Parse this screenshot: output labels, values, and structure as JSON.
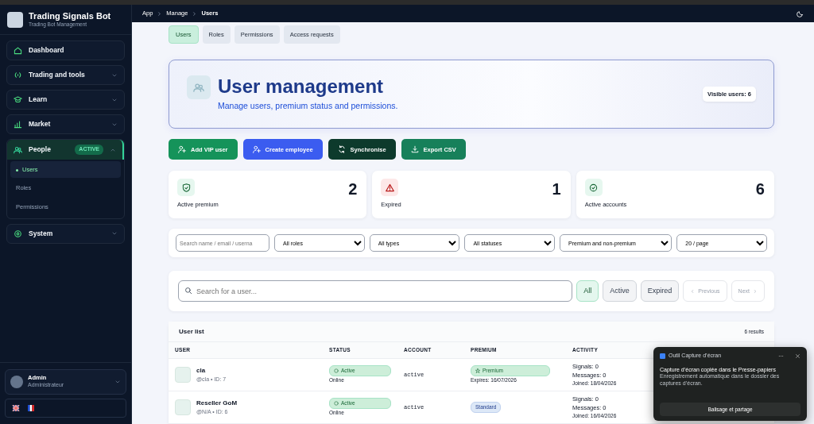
{
  "app": {
    "title": "Trading Signals Bot",
    "subtitle": "Trading Bot Management"
  },
  "sidebar": {
    "items": [
      {
        "label": "Dashboard",
        "expandable": false,
        "selected": false
      },
      {
        "label": "Trading and tools",
        "expandable": true,
        "expanded": false,
        "selected": false
      },
      {
        "label": "Learn",
        "expandable": true,
        "expanded": false,
        "selected": false
      },
      {
        "label": "Market",
        "expandable": true,
        "expanded": false,
        "selected": false
      },
      {
        "label": "People",
        "expandable": true,
        "expanded": true,
        "selected": true,
        "badge": "ACTIVE",
        "children": [
          {
            "label": "Users",
            "selected": true
          },
          {
            "label": "Roles",
            "selected": false
          },
          {
            "label": "Permissions",
            "selected": false
          }
        ]
      },
      {
        "label": "System",
        "expandable": true,
        "expanded": false,
        "selected": false
      }
    ]
  },
  "user": {
    "name": "Admin",
    "role": "Administrateur"
  },
  "breadcrumb": [
    "App",
    "Manage",
    "Users"
  ],
  "tabs": [
    {
      "label": "Users",
      "selected": true
    },
    {
      "label": "Roles",
      "selected": false
    },
    {
      "label": "Permissions",
      "selected": false
    },
    {
      "label": "Access requests",
      "selected": false
    }
  ],
  "header": {
    "title": "User management",
    "subtitle": "Manage users, premium status and permissions.",
    "badge": "Visible users: 6"
  },
  "actions": [
    {
      "label": "Add VIP user",
      "color": "#15935a"
    },
    {
      "label": "Create employee",
      "color": "#3b5cf0"
    },
    {
      "label": "Synchronise",
      "color": "#0d3a2c"
    },
    {
      "label": "Export CSV",
      "color": "#17805a"
    }
  ],
  "stats": [
    {
      "kind": "premium",
      "label": "Active premium",
      "value": "2"
    },
    {
      "kind": "expired",
      "label": "Expired",
      "value": "1"
    },
    {
      "kind": "accounts",
      "label": "Active accounts",
      "value": "6"
    }
  ],
  "filters": {
    "placeholder": "Search name / email / userna",
    "selects": [
      "All roles",
      "All types",
      "All statuses",
      "Premium and non-premium",
      "20 / page"
    ]
  },
  "search": {
    "placeholder": "Search for a user...",
    "segments": [
      {
        "label": "All",
        "selected": true
      },
      {
        "label": "Active",
        "selected": false
      },
      {
        "label": "Expired",
        "selected": false
      }
    ],
    "pager": [
      {
        "label": "Previous",
        "disabled": true
      },
      {
        "label": "Next",
        "disabled": true
      }
    ]
  },
  "table": {
    "title": "User list",
    "count": "6 results",
    "columns": [
      "USER",
      "STATUS",
      "ACCOUNT",
      "PREMIUM",
      "ACTIVITY"
    ],
    "rows": [
      {
        "name": "cla",
        "handle": "@cla • ID: 7",
        "status": "Active",
        "presence": "Online",
        "account": "active",
        "premium": {
          "kind": "premium",
          "label": "Premium"
        },
        "expires": "Expires: 16/07/2026",
        "signals": "Signals: 0",
        "messages": "Messages: 0",
        "joined": "Joined: 18/04/2026"
      },
      {
        "name": "Reseller GoM",
        "handle": "@N/A • ID: 6",
        "status": "Active",
        "presence": "Online",
        "account": "active",
        "premium": {
          "kind": "standard",
          "label": "Standard"
        },
        "signals": "Signals: 0",
        "messages": "Messages: 0",
        "joined": "Joined: 16/04/2026"
      }
    ]
  },
  "notification": {
    "app": "Outil Capture d’écran",
    "title": "Capture d’écran copiée dans le Presse-papiers",
    "body": "Enregistrement automatique dans le dossier des captures d’écran.",
    "button": "Balisage et partage"
  }
}
